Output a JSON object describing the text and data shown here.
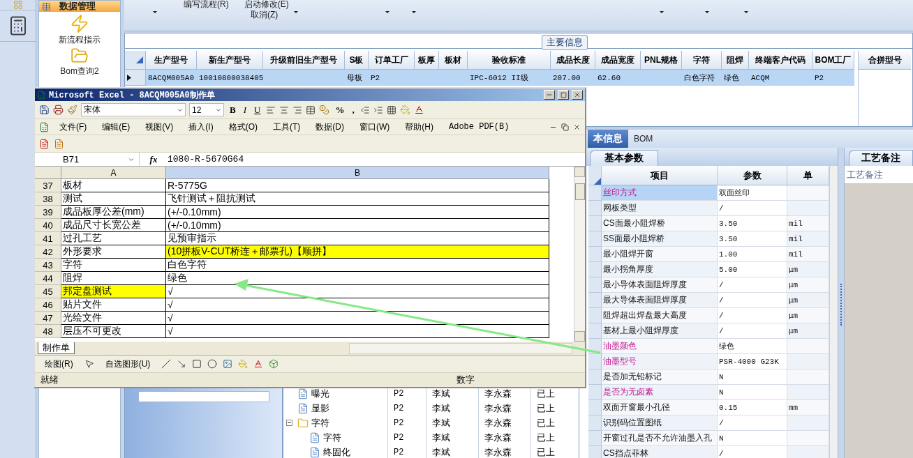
{
  "sidebar": {
    "header": "数据管理",
    "items": [
      {
        "label": "新流程指示",
        "kind": "lightning"
      },
      {
        "label": "Bom查询2",
        "kind": "folder"
      }
    ]
  },
  "ribbon": {
    "row_1": [
      "编写流程(R)",
      "启动修改(E)"
    ],
    "row_2": [
      "取消(Z)"
    ]
  },
  "main_info": {
    "title": "主要信息",
    "columns": [
      "生产型号",
      "新生产型号",
      "升级前旧生产型号",
      "S板",
      "订单工厂",
      "板厚",
      "板材",
      "验收标准",
      "成品长度",
      "成品宽度",
      "PNL规格",
      "字符",
      "阻焊",
      "终端客户代码",
      "BOM工厂"
    ],
    "rows": [
      {
        "selected": true,
        "cells": [
          "8ACQM005A0",
          "10010800038405",
          "",
          "母板",
          "P2",
          "",
          "",
          "IPC-6012 II级",
          "207.00",
          "62.60",
          "",
          "白色字符",
          "绿色",
          "ACQM",
          "P2"
        ]
      }
    ]
  },
  "merge_panel": {
    "title": "合拼型号"
  },
  "tree": {
    "nodes": [
      {
        "children": [
          {
            "kind": "file",
            "label": "曝光",
            "cells": [
              "P2",
              "李斌",
              "李永森",
              "已上"
            ]
          },
          {
            "kind": "file",
            "label": "显影",
            "cells": [
              "P2",
              "李斌",
              "李永森",
              "已上"
            ]
          }
        ]
      },
      {
        "kind": "folder",
        "label": "字符",
        "expanded": true,
        "cells": [
          "P2",
          "李斌",
          "李永森",
          "已上"
        ],
        "children": [
          {
            "kind": "file",
            "label": "字符",
            "cells": [
              "P2",
              "李斌",
              "李永森",
              "已上"
            ]
          },
          {
            "kind": "file",
            "label": "终固化",
            "cells": [
              "P2",
              "李斌",
              "李永森",
              "已上"
            ]
          }
        ]
      }
    ]
  },
  "detail": {
    "tabs": [
      {
        "label": "本信息",
        "selected": true
      },
      {
        "label": "BOM",
        "selected": false
      }
    ],
    "subtab": "基本参数",
    "columns": [
      "项目",
      "参数",
      "单"
    ],
    "rows": [
      {
        "name": "丝印方式",
        "value": "双面丝印",
        "unit": "",
        "flagged": true,
        "selected": true
      },
      {
        "name": "网板类型",
        "value": "/",
        "unit": "",
        "flagged": false,
        "selected": false
      },
      {
        "name": "CS面最小阻焊桥",
        "value": "3.50",
        "unit": "mil",
        "flagged": false,
        "selected": false
      },
      {
        "name": "SS面最小阻焊桥",
        "value": "3.50",
        "unit": "mil",
        "flagged": false,
        "selected": false
      },
      {
        "name": "最小阻焊开窗",
        "value": "1.00",
        "unit": "mil",
        "flagged": false,
        "selected": false
      },
      {
        "name": "最小拐角厚度",
        "value": "5.00",
        "unit": "μm",
        "flagged": false,
        "selected": false
      },
      {
        "name": "最小导体表面阻焊厚度",
        "value": "/",
        "unit": "μm",
        "flagged": false,
        "selected": false
      },
      {
        "name": "最大导体表面阻焊厚度",
        "value": "/",
        "unit": "μm",
        "flagged": false,
        "selected": false
      },
      {
        "name": "阻焊超出焊盘最大高度",
        "value": "/",
        "unit": "μm",
        "flagged": false,
        "selected": false
      },
      {
        "name": "基材上最小阻焊厚度",
        "value": "/",
        "unit": "μm",
        "flagged": false,
        "selected": false
      },
      {
        "name": "油墨颜色",
        "value": "绿色",
        "unit": "",
        "flagged": true,
        "selected": false
      },
      {
        "name": "油墨型号",
        "value": "PSR-4000 G23K",
        "unit": "",
        "flagged": true,
        "selected": false
      },
      {
        "name": "是否加无铅标记",
        "value": "N",
        "unit": "",
        "flagged": false,
        "selected": false
      },
      {
        "name": "是否为无卤素",
        "value": "N",
        "unit": "",
        "flagged": true,
        "selected": false
      },
      {
        "name": "双面开窗最小孔径",
        "value": "0.15",
        "unit": "mm",
        "flagged": false,
        "selected": false
      },
      {
        "name": "识别码位置图纸",
        "value": "/",
        "unit": "",
        "flagged": false,
        "selected": false
      },
      {
        "name": "开窗过孔是否不允许油墨入孔",
        "value": "N",
        "unit": "",
        "flagged": false,
        "selected": false
      },
      {
        "name": "CS挡点菲林",
        "value": "/",
        "unit": "",
        "flagged": false,
        "selected": false
      }
    ]
  },
  "notes": {
    "tab": "工艺备注",
    "header": "工艺备注"
  },
  "excel": {
    "title": "Microsoft Excel - 8ACQM005A0制作单",
    "font": "宋体",
    "size": "12",
    "format_buttons": [
      "B",
      "I",
      "U"
    ],
    "number_buttons": [
      "%",
      ","
    ],
    "menu": [
      "文件(F)",
      "编辑(E)",
      "视图(V)",
      "插入(I)",
      "格式(O)",
      "工具(T)",
      "数据(D)",
      "窗口(W)",
      "帮助(H)",
      "Adobe PDF(B)"
    ],
    "name_box": "B71",
    "fx": "fx",
    "formula": "1080-R-5670G64",
    "columns": [
      "A",
      "B"
    ],
    "rows": [
      {
        "num": "37",
        "a": "板材",
        "b": "R-5775G",
        "a_yellow": false,
        "b_yellow": false
      },
      {
        "num": "38",
        "a": "测试",
        "b": "飞针测试＋阻抗测试",
        "a_yellow": false,
        "b_yellow": false
      },
      {
        "num": "39",
        "a": "成品板厚公差(mm)",
        "b": "(+/-0.10mm)",
        "a_yellow": false,
        "b_yellow": false
      },
      {
        "num": "40",
        "a": "成品尺寸长宽公差",
        "b": "(+/-0.10mm)",
        "a_yellow": false,
        "b_yellow": false
      },
      {
        "num": "41",
        "a": "过孔工艺",
        "b": "见预审指示",
        "a_yellow": false,
        "b_yellow": false
      },
      {
        "num": "42",
        "a": "外形要求",
        "b": "(10拼板V-CUT桥连＋邮票孔)【顺拼】",
        "a_yellow": false,
        "b_yellow": true
      },
      {
        "num": "43",
        "a": "字符",
        "b": "白色字符",
        "a_yellow": false,
        "b_yellow": false
      },
      {
        "num": "44",
        "a": "阻焊",
        "b": "绿色",
        "a_yellow": false,
        "b_yellow": false
      },
      {
        "num": "45",
        "a": "邦定盘测试",
        "b": "√",
        "a_yellow": true,
        "b_yellow": false
      },
      {
        "num": "46",
        "a": "贴片文件",
        "b": "√",
        "a_yellow": false,
        "b_yellow": false
      },
      {
        "num": "47",
        "a": "光绘文件",
        "b": "√",
        "a_yellow": false,
        "b_yellow": false
      },
      {
        "num": "48",
        "a": "层压不可更改",
        "b": "√",
        "a_yellow": false,
        "b_yellow": false
      }
    ],
    "sheet_tab": "制作单",
    "draw_menu": "绘图(R)",
    "autoshape_menu": "自选图形(U)",
    "status": "就绪",
    "status_mode": "数字"
  }
}
